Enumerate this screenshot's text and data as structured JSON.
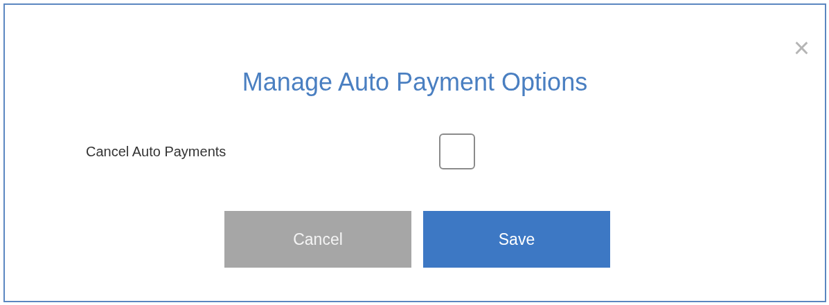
{
  "dialog": {
    "title": "Manage Auto Payment Options",
    "close": "×"
  },
  "option": {
    "label": "Cancel Auto Payments",
    "checked": false
  },
  "buttons": [
    {
      "label": "Cancel",
      "kind": "secondary"
    },
    {
      "label": "Save",
      "kind": "primary"
    }
  ]
}
